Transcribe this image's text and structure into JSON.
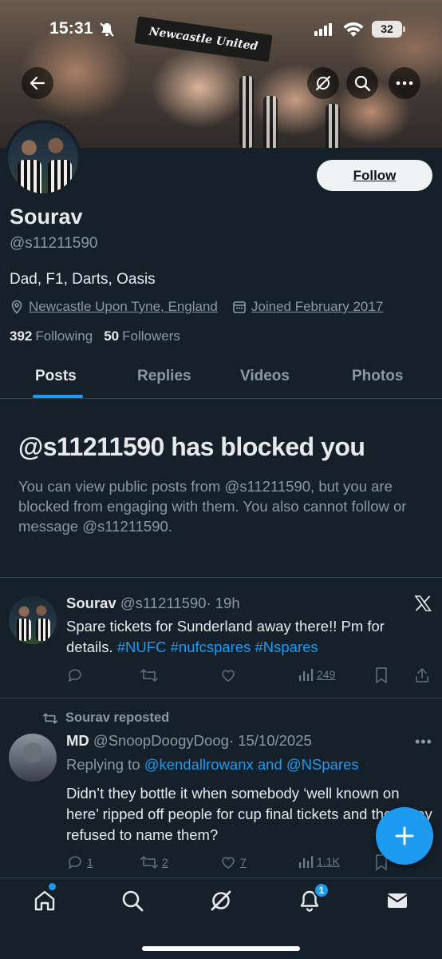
{
  "status_bar": {
    "time": "15:31",
    "battery": "32"
  },
  "banner": {
    "scarf_text": "Newcastle United"
  },
  "header_actions": {
    "back_icon": "back-arrow-icon",
    "grok_icon": "grok-icon",
    "search_icon": "search-icon",
    "more_icon": "more-icon"
  },
  "profile": {
    "follow_label": "Follow",
    "name": "Sourav",
    "handle": "@s11211590",
    "bio": "Dad, F1, Darts, Oasis",
    "location": "Newcastle Upon Tyne, England",
    "joined": "Joined February 2017",
    "following_count": "392",
    "following_label": "Following",
    "followers_count": "50",
    "followers_label": "Followers"
  },
  "tabs": [
    {
      "label": "Posts",
      "active": true
    },
    {
      "label": "Replies",
      "active": false
    },
    {
      "label": "Videos",
      "active": false
    },
    {
      "label": "Photos",
      "active": false
    }
  ],
  "blocked": {
    "title": "@s11211590 has blocked you",
    "message": "You can view public posts from @s11211590, but you are blocked from engaging with them. You also cannot follow or message @s11211590."
  },
  "tweets": [
    {
      "name": "Sourav",
      "handle": "@s11211590",
      "time": "· 19h",
      "text_before": "Spare tickets for Sunderland away there!! Pm for details. ",
      "hashtags": "#NUFC #nufcspares #Nspares",
      "views": "249"
    },
    {
      "reposted_by": "Sourav reposted",
      "name": "MD",
      "handle": "@SnoopDoogyDoog",
      "time": "· 15/10/2025",
      "replying_label": "Replying to ",
      "replying_to": "@kendallrowanx and @NSpares",
      "text": "Didn’t they bottle it when somebody ‘well known on here’ ripped off people for cup final tickets and then they refused to name them?",
      "replies": "1",
      "reposts": "2",
      "likes": "7",
      "views": "1.1K"
    }
  ],
  "bottom_nav": {
    "notifications_badge": "1"
  },
  "colors": {
    "background": "#15202b",
    "accent": "#1d9bf0",
    "secondary_text": "#8b98a5"
  }
}
